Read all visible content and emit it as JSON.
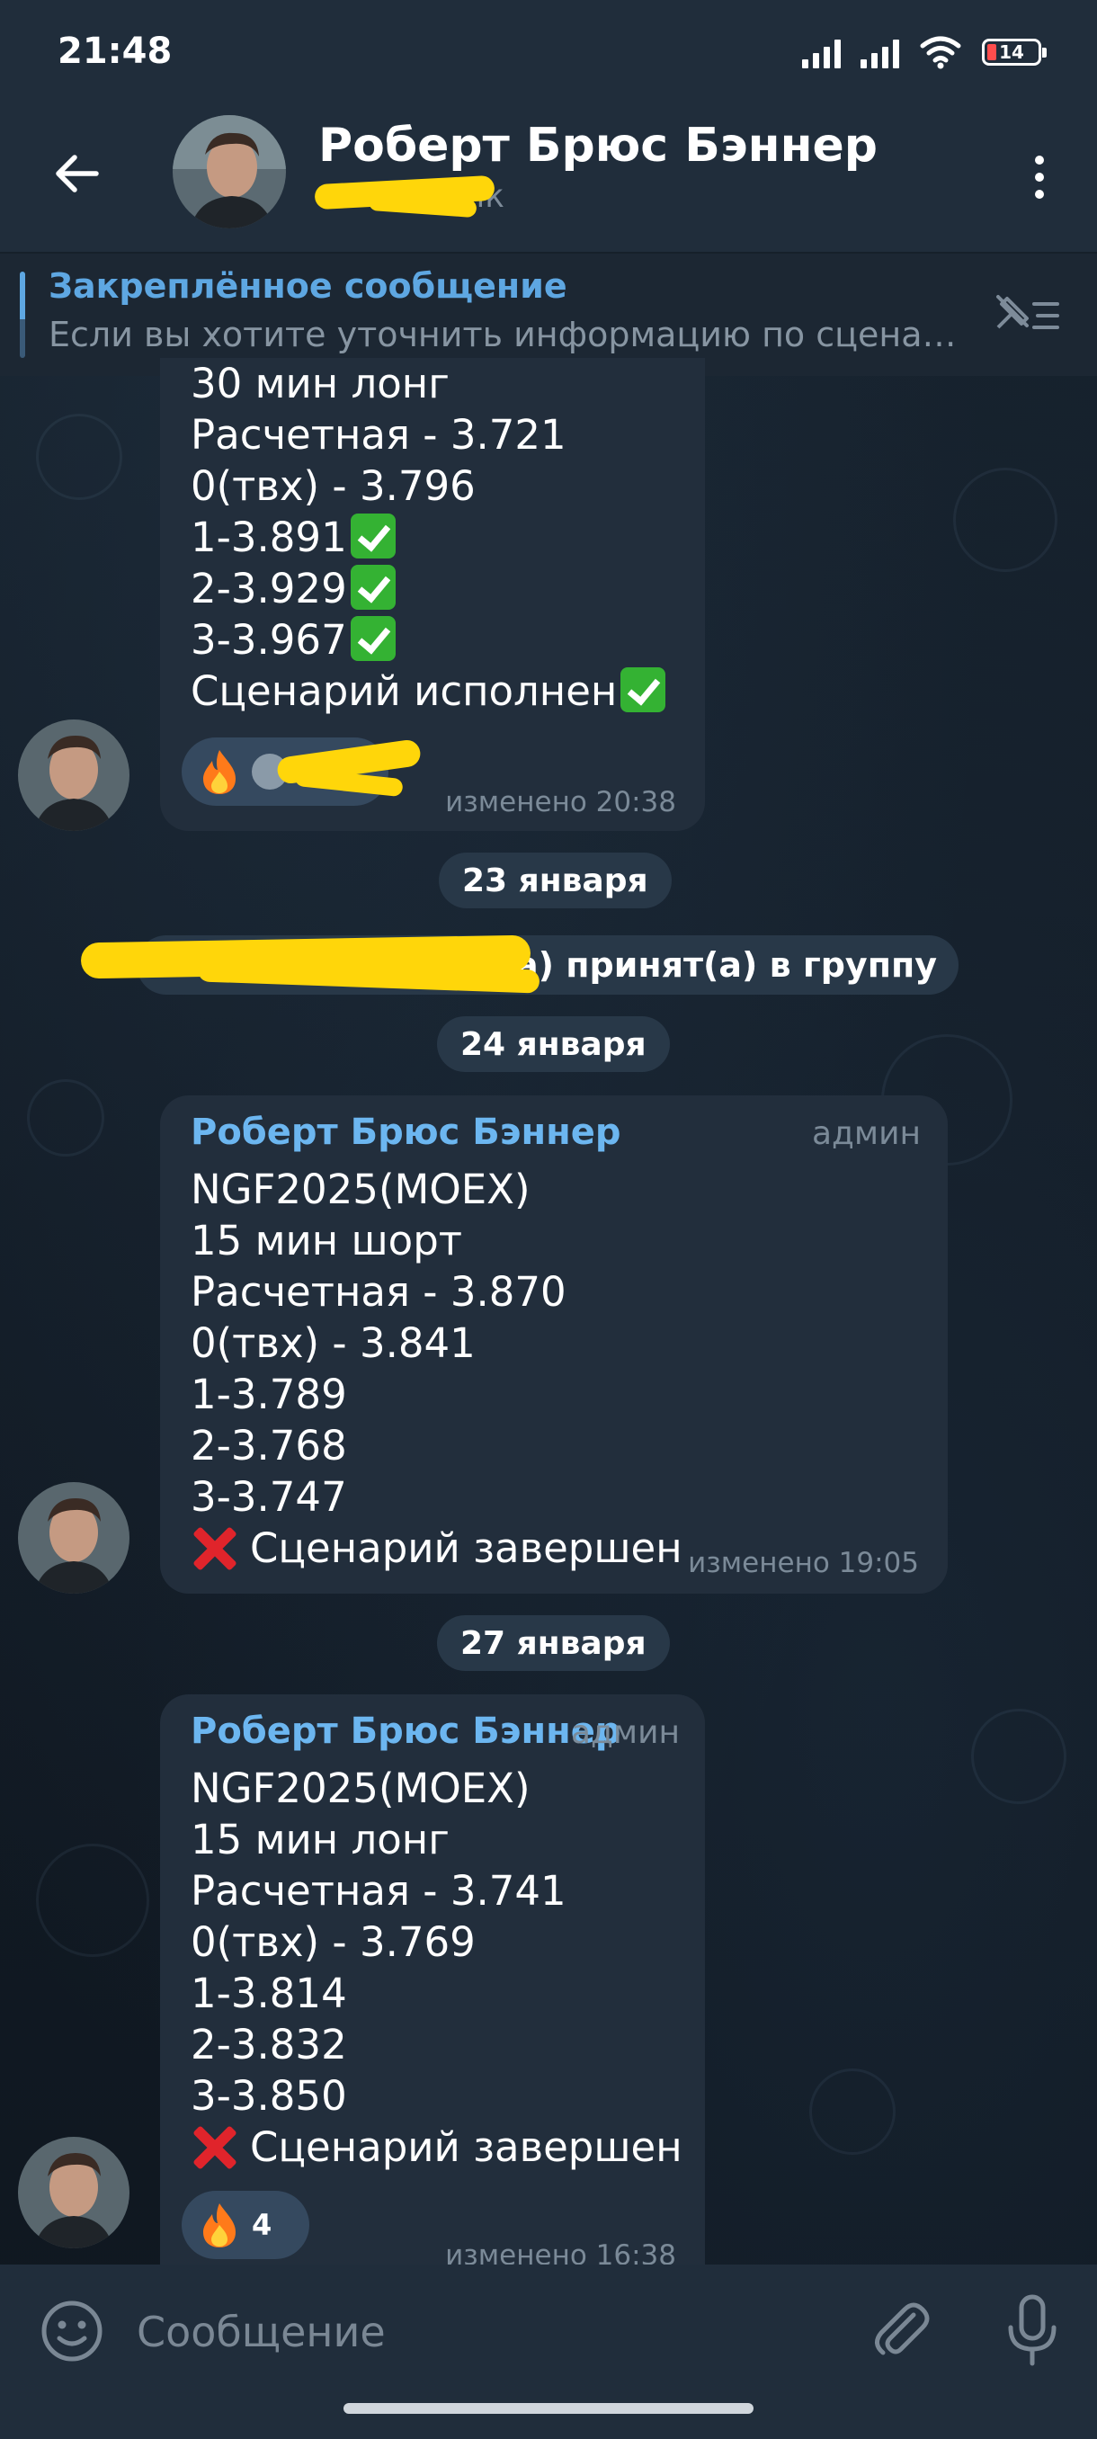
{
  "status_bar": {
    "time": "21:48",
    "battery": "14"
  },
  "header": {
    "title": "Роберт Брюс Бэннер",
    "subtitle_visible": "щик"
  },
  "pinned": {
    "title": "Закреплённое сообщение",
    "text": "Если вы хотите уточнить информацию по сценари..."
  },
  "messages": [
    {
      "lines": [
        "30 мин лонг",
        "Расчетная - 3.721",
        "0(твх) - 3.796"
      ],
      "checked_lines": [
        "1-3.891",
        "2-3.929",
        "3-3.967",
        "Сценарий исполнен"
      ],
      "meta": "изменено 20:38",
      "reaction_icon": "fire-emoji"
    },
    {
      "sender": "Роберт Брюс Бэннер",
      "role": "админ",
      "lines": [
        "NGF2025(MOEX)",
        "15 мин шорт",
        "Расчетная - 3.870",
        "0(твх) - 3.841",
        "1-3.789",
        "2-3.768",
        "3-3.747"
      ],
      "status_line": "Сценарий завершен",
      "meta": "изменено 19:05"
    },
    {
      "sender": "Роберт Брюс Бэннер",
      "role": "админ",
      "lines": [
        "NGF2025(MOEX)",
        "15 мин лонг",
        "Расчетная - 3.741",
        "0(твх) - 3.769",
        "1-3.814",
        "2-3.832",
        "3-3.850"
      ],
      "status_line": "Сценарий завершен",
      "reaction_icon": "fire-emoji",
      "reaction_count": "4",
      "meta": "изменено 16:38"
    }
  ],
  "dates": [
    "23 января",
    "24 января",
    "27 января"
  ],
  "service_message": "в был(а) принят(а) в группу",
  "composer": {
    "placeholder": "Сообщение"
  },
  "colors": {
    "accent": "#5ea7e2",
    "bubble": "#222e3c",
    "header": "#202d3b",
    "check": "#34b233",
    "cross": "#e0242b",
    "redaction": "#ffd60a"
  }
}
